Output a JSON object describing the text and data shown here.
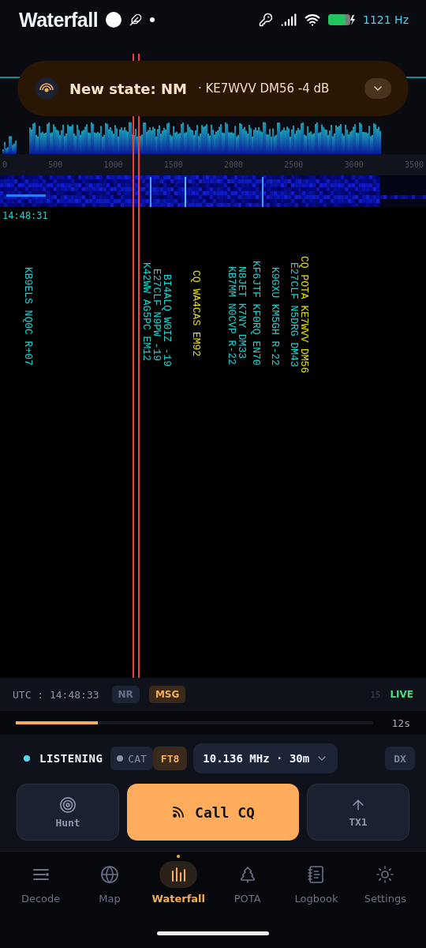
{
  "status_bar": {
    "title": "Waterfall",
    "readout": "1121 Hz"
  },
  "notification": {
    "title": "New state: NM",
    "detail": "· KE7WVV  DM56  -4 dB",
    "expanded": false
  },
  "spectrum": {
    "axis_labels": [
      "0",
      "500",
      "1000",
      "1500",
      "2000",
      "2500",
      "3000",
      "3500"
    ]
  },
  "decode_time": "14:48:31",
  "decodes": [
    {
      "text": "KB9ELS NQ0C R+07",
      "color": "#19d6d6"
    },
    {
      "text": "K42WW AG5PC EM12",
      "color": "#19d6d6"
    },
    {
      "text": "E27CLF N9PW -19",
      "color": "#19d6d6"
    },
    {
      "text": "BI4ALQ W0IZ -19",
      "color": "#19d6d6"
    },
    {
      "text": "CQ WA4CAS EM92",
      "color": "#e6e000"
    },
    {
      "text": "KB7MM N0CVP R-22",
      "color": "#19d6d6"
    },
    {
      "text": "N8JET K7NY DM33",
      "color": "#19d6d6"
    },
    {
      "text": "KF6JTF KF0RQ EN70",
      "color": "#19d6d6"
    },
    {
      "text": "K9GXU KM5GH R-22",
      "color": "#19d6d6"
    },
    {
      "text": "E27CLF N5DRG DM43",
      "color": "#19d6d6"
    },
    {
      "text": "CQ POTA KE7WVV DM56",
      "color": "#e6e000"
    }
  ],
  "status_row": {
    "utc": "UTC : 14:48:33",
    "chips": [
      {
        "label": "NR",
        "on": false
      },
      {
        "label": "MSG",
        "on": true
      }
    ],
    "count": "15",
    "live": "LIVE"
  },
  "cycle": {
    "level": 0.23,
    "remaining": "12s"
  },
  "radio": {
    "state": "LISTENING",
    "cat": {
      "label": "CAT",
      "connected": false
    },
    "mode": {
      "label": "FT8",
      "on": true
    },
    "frequency": "10.136 MHz · 30m",
    "dx": {
      "label": "DX",
      "on": false
    }
  },
  "actions": [
    {
      "label": "Hunt",
      "kind": "hunt"
    },
    {
      "label": "Call CQ",
      "kind": "cq"
    },
    {
      "label": "TX1",
      "kind": "tx"
    }
  ],
  "nav": [
    {
      "label": "Decode",
      "kind": "decode",
      "selected": false
    },
    {
      "label": "Map",
      "kind": "map",
      "selected": false
    },
    {
      "label": "Waterfall",
      "kind": "waterfall",
      "selected": true
    },
    {
      "label": "POTA",
      "kind": "pota",
      "selected": false
    },
    {
      "label": "Logbook",
      "kind": "logbook",
      "selected": false
    },
    {
      "label": "Settings",
      "kind": "settings",
      "selected": false
    }
  ]
}
